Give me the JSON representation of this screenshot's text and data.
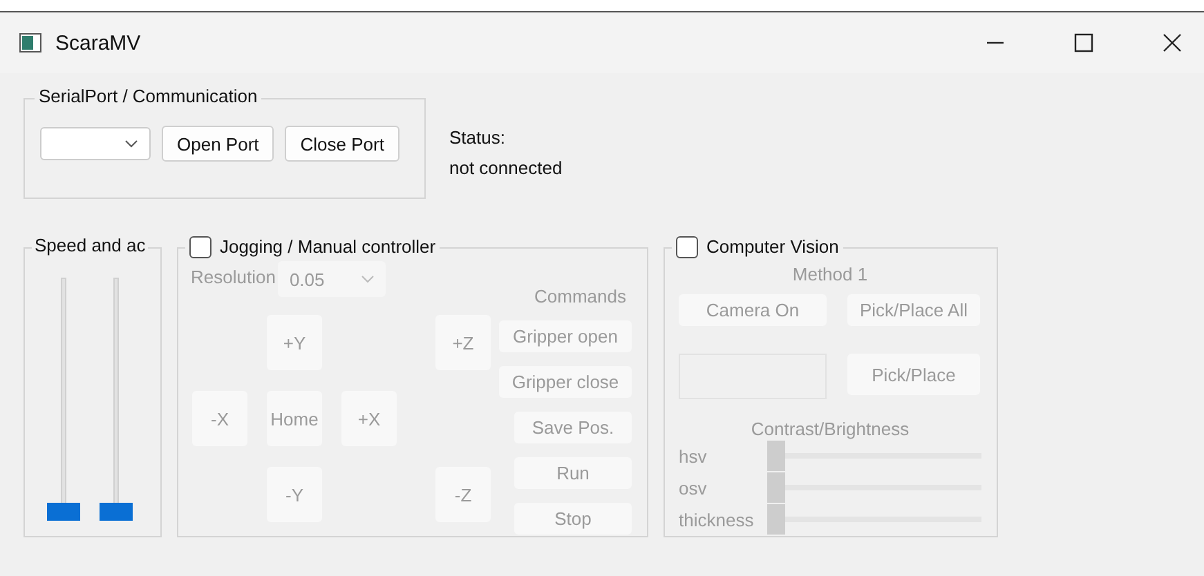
{
  "window": {
    "title": "ScaraMV"
  },
  "serial": {
    "title": "SerialPort / Communication",
    "buttons": [
      "Open Port",
      "Close Port"
    ]
  },
  "status": {
    "label": "Status:",
    "value": "not connected"
  },
  "speed": {
    "title": "Speed and ac",
    "sliders": [
      {
        "level": 0
      },
      {
        "level": 0
      }
    ]
  },
  "jogging": {
    "title": "Jogging / Manual controller",
    "checked": false,
    "resolution": {
      "label": "Resolution",
      "value": "0.05"
    },
    "jog_buttons": [
      "+Y",
      "+Z",
      "-X",
      "Home",
      "+X",
      "-Y",
      "-Z"
    ],
    "commands_title": "Commands",
    "commands": [
      "Gripper open",
      "Gripper close",
      "Save Pos.",
      "Run",
      "Stop"
    ]
  },
  "vision": {
    "title": "Computer Vision",
    "checked": false,
    "method": "Method 1",
    "buttons": [
      "Camera On",
      "Pick/Place All",
      "Pick/Place"
    ],
    "contrast_title": "Contrast/Brightness",
    "sliders": [
      {
        "label": "hsv",
        "level": 0
      },
      {
        "label": "osv",
        "level": 0
      },
      {
        "label": "thickness",
        "level": 0
      }
    ]
  }
}
